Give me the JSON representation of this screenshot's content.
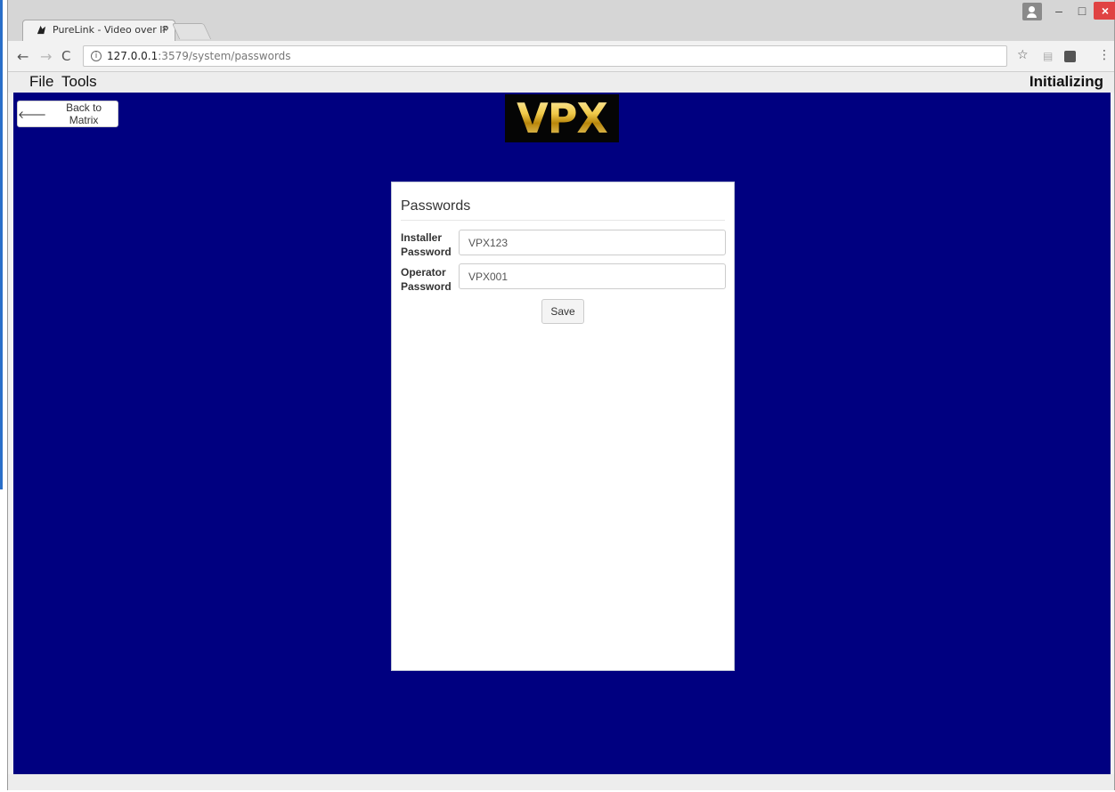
{
  "browser": {
    "tab_title": "PureLink - Video over IP",
    "tab_close": "×",
    "url_host": "127.0.0.1",
    "url_rest": ":3579/system/passwords",
    "nav": {
      "back": "←",
      "forward": "→",
      "reload": "C"
    },
    "star": "☆",
    "menu": "⋮",
    "window_controls": {
      "minimize": "–",
      "maximize": "□",
      "close": "×"
    }
  },
  "app": {
    "menu": {
      "file": "File",
      "tools": "Tools"
    },
    "status": "Initializing",
    "back_button": "Back to Matrix",
    "logo_text": "VPX",
    "panel": {
      "title": "Passwords",
      "installer_label": "Installer Password",
      "installer_value": "VPX123",
      "operator_label": "Operator Password",
      "operator_value": "VPX001",
      "save_label": "Save"
    }
  },
  "colors": {
    "app_background": "#000080",
    "logo_gold": "#e8c14a",
    "close_button": "#e04343"
  }
}
